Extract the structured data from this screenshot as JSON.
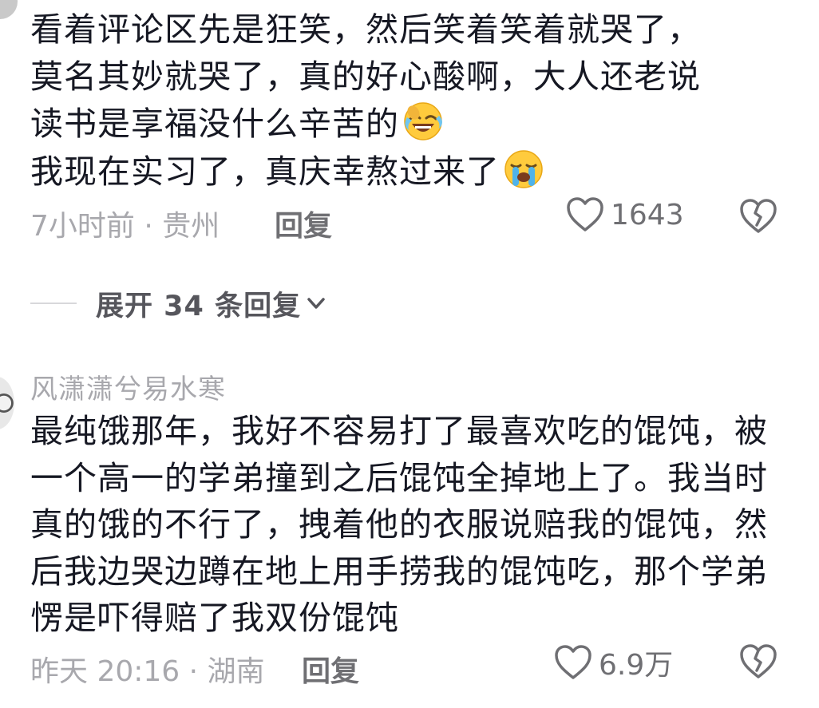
{
  "comments": [
    {
      "text_lines": [
        "看着评论区先是狂笑，然后笑着笑着就哭了，",
        "莫名其妙就哭了，真的好心酸啊，大人还老说",
        "读书是享福没什么辛苦的"
      ],
      "text_line4": "我现在实习了，真庆幸熬过来了",
      "emoji1": "laughing-crying-face",
      "emoji2": "loudly-crying-face",
      "time_location": "7小时前 · 贵州",
      "reply_label": "回复",
      "like_count": "1643"
    },
    {
      "username": "风潇潇兮易水寒",
      "text": "最纯饿那年，我好不容易打了最喜欢吃的馄饨，被一个高一的学弟撞到之后馄饨全掉地上了。我当时真的饿的不行了，拽着他的衣服说赔我的馄饨，然后我边哭边蹲在地上用手捞我的馄饨吃，那个学弟愣是吓得赔了我双份馄饨",
      "time_location": "昨天 20:16 · 湖南",
      "reply_label": "回复",
      "like_count": "6.9万"
    }
  ],
  "expand_replies": {
    "label": "展开 34 条回复"
  },
  "colors": {
    "text_primary": "#161823",
    "text_secondary": "#a8a8ad",
    "text_action": "#6f6f73"
  }
}
